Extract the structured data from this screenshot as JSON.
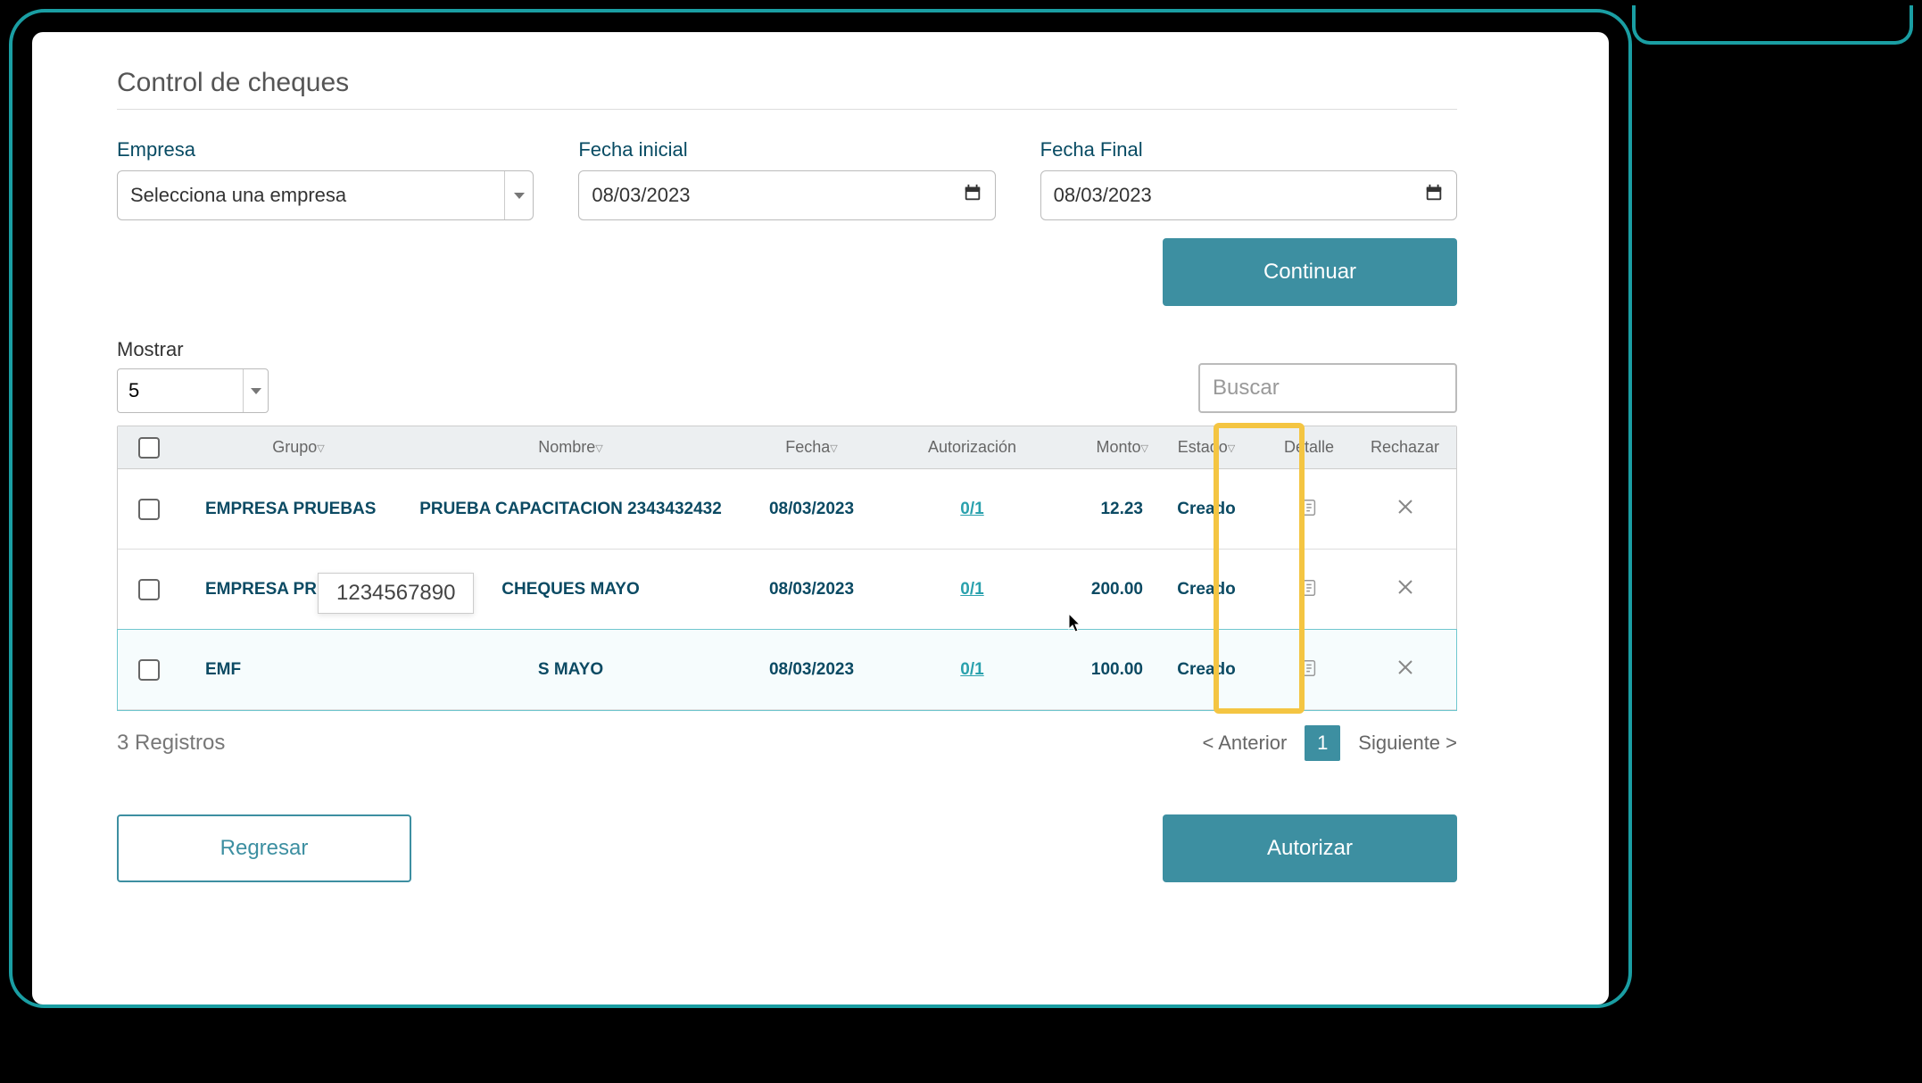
{
  "page": {
    "title": "Control de cheques"
  },
  "filters": {
    "empresa": {
      "label": "Empresa",
      "placeholder": "Selecciona una empresa"
    },
    "fecha_inicial": {
      "label": "Fecha inicial",
      "value": "08/03/2023"
    },
    "fecha_final": {
      "label": "Fecha Final",
      "value": "08/03/2023"
    },
    "continue_label": "Continuar"
  },
  "list": {
    "show_label": "Mostrar",
    "show_value": "5",
    "search_placeholder": "Buscar"
  },
  "table": {
    "headers": {
      "grupo": "Grupo",
      "nombre": "Nombre",
      "fecha": "Fecha",
      "autorizacion": "Autorización",
      "monto": "Monto",
      "estado": "Estado",
      "detalle": "Detalle",
      "rechazar": "Rechazar"
    },
    "rows": [
      {
        "grupo": "EMPRESA PRUEBAS",
        "nombre": "PRUEBA CAPACITACION 2343432432",
        "fecha": "08/03/2023",
        "auth": "0/1",
        "monto": "12.23",
        "estado": "Creado"
      },
      {
        "grupo": "EMPRESA PRUEBAS",
        "nombre": "CHEQUES MAYO",
        "fecha": "08/03/2023",
        "auth": "0/1",
        "monto": "200.00",
        "estado": "Creado"
      },
      {
        "grupo": "EMF",
        "nombre": "S MAYO",
        "fecha": "08/03/2023",
        "auth": "0/1",
        "monto": "100.00",
        "estado": "Creado"
      }
    ],
    "tooltip": "1234567890"
  },
  "footer": {
    "records": "3 Registros",
    "prev": "< Anterior",
    "page": "1",
    "next": "Siguiente >"
  },
  "actions": {
    "back": "Regresar",
    "authorize": "Autorizar"
  }
}
